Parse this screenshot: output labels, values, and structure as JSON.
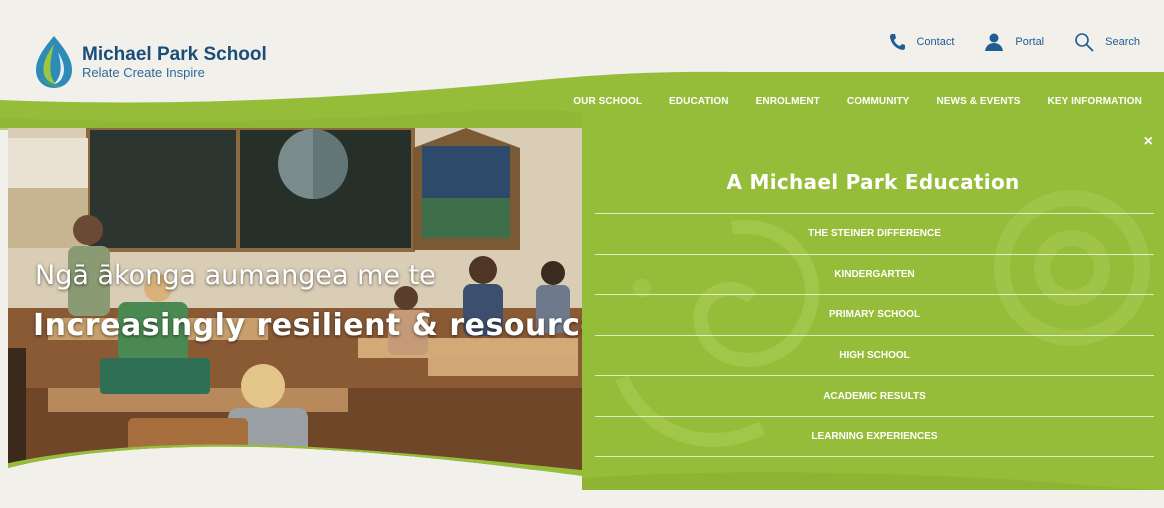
{
  "site": {
    "name": "Michael Park School",
    "tagline": "Relate Create Inspire"
  },
  "utility_nav": [
    {
      "label": "Contact",
      "icon": "phone-icon"
    },
    {
      "label": "Portal",
      "icon": "user-icon"
    },
    {
      "label": "Search",
      "icon": "search-icon"
    }
  ],
  "main_nav": [
    "OUR SCHOOL",
    "EDUCATION",
    "ENROLMENT",
    "COMMUNITY",
    "NEWS & EVENTS",
    "KEY INFORMATION"
  ],
  "hero": {
    "line1": "Ngā ākonga aumangea me te",
    "line2": "Increasingly resilient & resourceful st"
  },
  "dropdown": {
    "close_label": "×",
    "title": "A Michael Park Education",
    "items": [
      "THE STEINER DIFFERENCE",
      "KINDERGARTEN",
      "PRIMARY SCHOOL",
      "HIGH SCHOOL",
      "ACADEMIC RESULTS",
      "LEARNING EXPERIENCES"
    ]
  },
  "colors": {
    "brand_green": "#96bd3a",
    "brand_blue": "#1a4d78",
    "background": "#f2f0eb"
  }
}
